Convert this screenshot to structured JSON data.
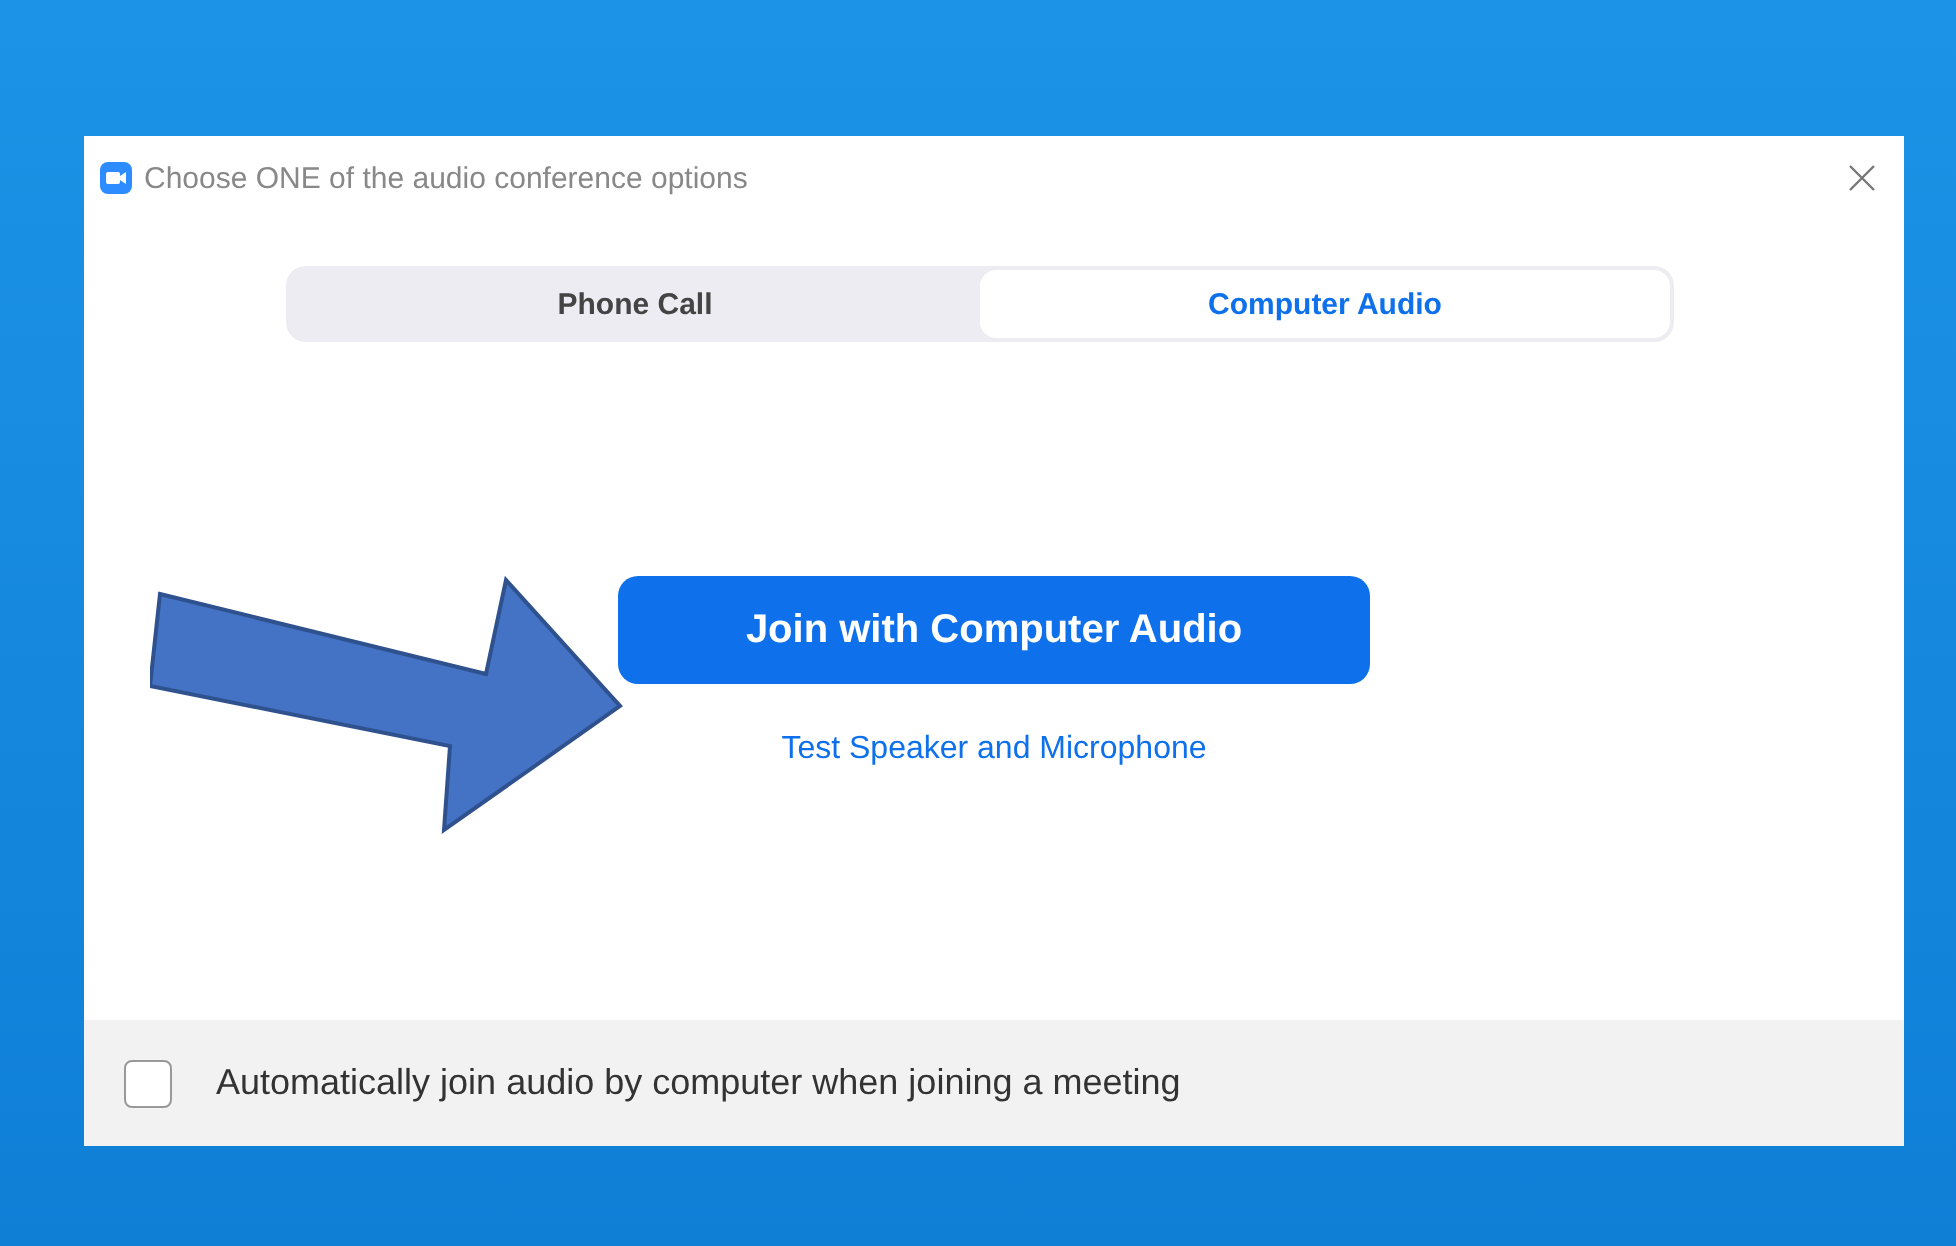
{
  "window": {
    "title": "Choose ONE of the audio conference options"
  },
  "tabs": [
    {
      "label": "Phone Call",
      "selected": false
    },
    {
      "label": "Computer Audio",
      "selected": true
    }
  ],
  "join_button": "Join with Computer Audio",
  "test_link": "Test Speaker and Microphone",
  "auto_join": {
    "label": "Automatically join audio by computer when joining a meeting",
    "checked": false
  }
}
